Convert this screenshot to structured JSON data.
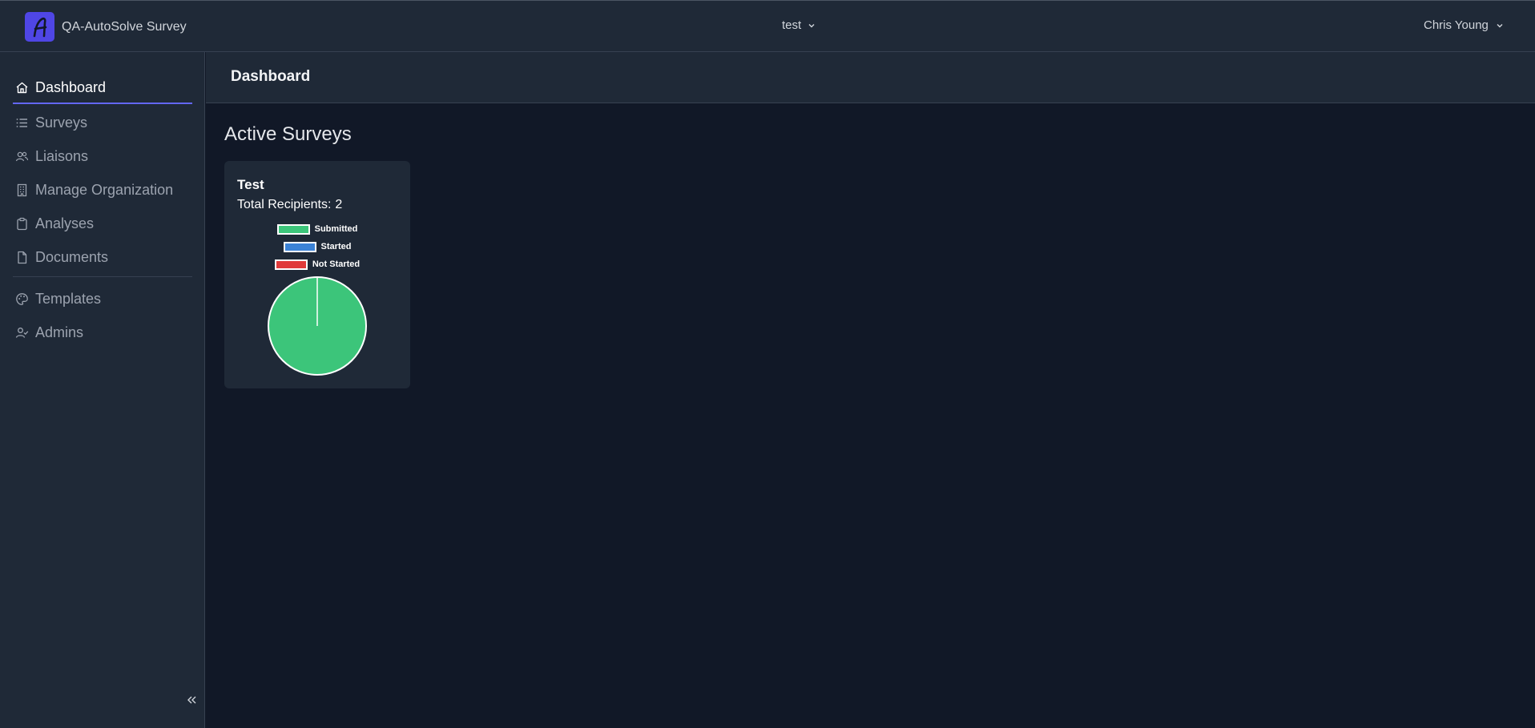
{
  "app": {
    "name": "QA-AutoSolve Survey",
    "logo_letter": "A",
    "accent_color": "#4f46e5"
  },
  "header": {
    "org_selector": "test",
    "user_name": "Chris Young"
  },
  "sidebar": {
    "items": [
      {
        "label": "Dashboard",
        "icon": "home-icon",
        "active": true
      },
      {
        "label": "Surveys",
        "icon": "list-icon"
      },
      {
        "label": "Liaisons",
        "icon": "users-icon"
      },
      {
        "label": "Manage Organization",
        "icon": "building-icon"
      },
      {
        "label": "Analyses",
        "icon": "clipboard-icon"
      },
      {
        "label": "Documents",
        "icon": "document-icon"
      },
      {
        "label": "Templates",
        "icon": "palette-icon"
      },
      {
        "label": "Admins",
        "icon": "user-check-icon"
      }
    ],
    "collapse_icon": "double-chevron-left-icon"
  },
  "page": {
    "title": "Dashboard",
    "section_title": "Active Surveys"
  },
  "survey_card": {
    "title": "Test",
    "recipients_label": "Total Recipients:",
    "recipients_count": "2"
  },
  "chart_data": {
    "type": "pie",
    "legend": [
      "Submitted",
      "Started",
      "Not Started"
    ],
    "categories": [
      "Submitted",
      "Started",
      "Not Started"
    ],
    "values": [
      2,
      0,
      0
    ],
    "colors": [
      "#3cc57a",
      "#3b82d6",
      "#e03a3a"
    ],
    "legend_position": "top"
  }
}
